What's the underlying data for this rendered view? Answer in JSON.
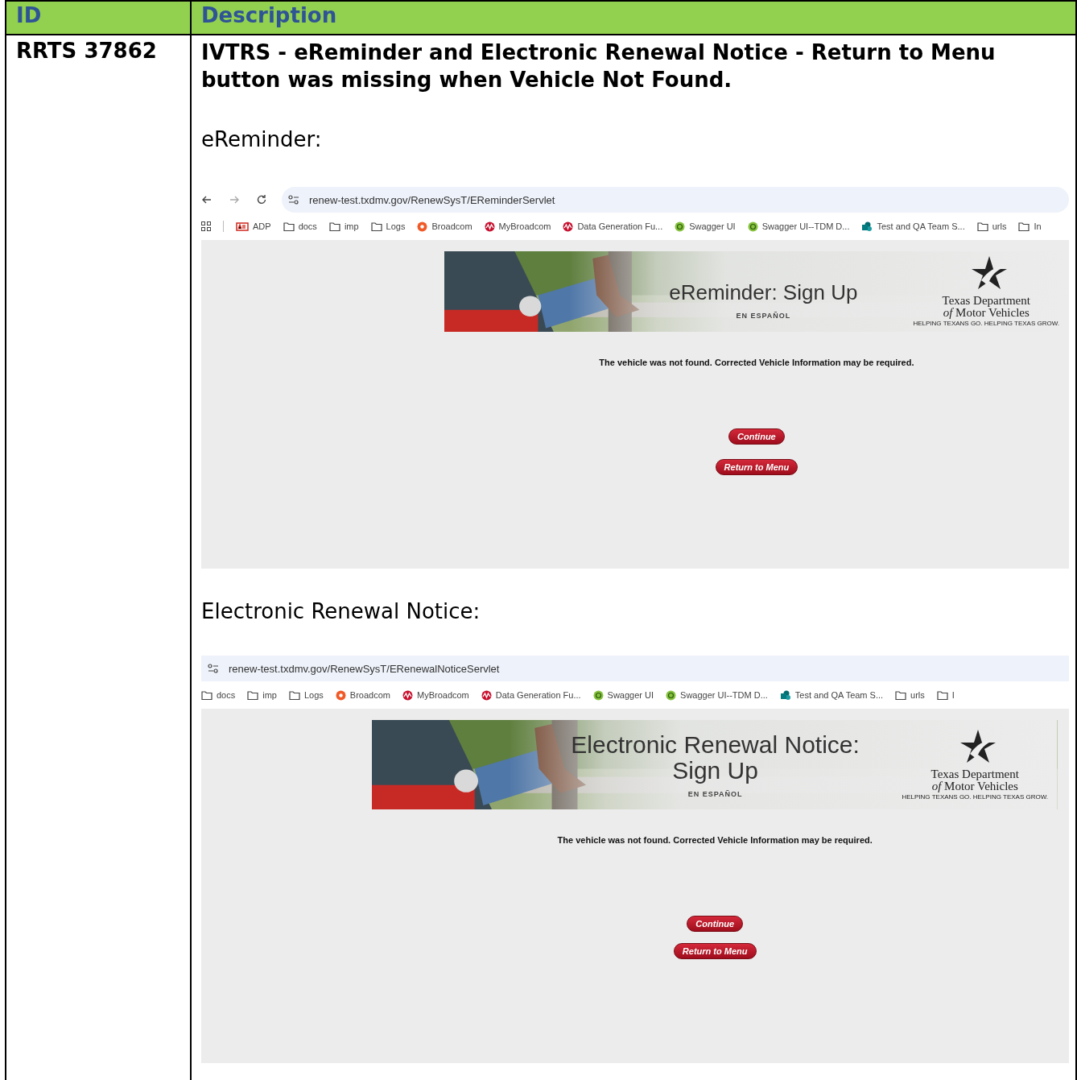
{
  "table": {
    "columns": [
      "ID",
      "Description"
    ],
    "rows": [
      {
        "id": "RRTS 37862",
        "title": "IVTRS - eReminder and Electronic Renewal Notice - Return to Menu button was missing when Vehicle Not Found.",
        "sections": [
          {
            "label": "eReminder:",
            "browser": {
              "nav_buttons": true,
              "url": "renew-test.txdmv.gov/RenewSysT/EReminderServlet",
              "bookmarks": [
                {
                  "label": "ADP",
                  "kind": "adp"
                },
                {
                  "label": "docs",
                  "kind": "folder"
                },
                {
                  "label": "imp",
                  "kind": "folder"
                },
                {
                  "label": "Logs",
                  "kind": "folder"
                },
                {
                  "label": "Broadcom",
                  "kind": "broadcom"
                },
                {
                  "label": "MyBroadcom",
                  "kind": "mybroadcom"
                },
                {
                  "label": "Data Generation Fu...",
                  "kind": "mybroadcom"
                },
                {
                  "label": "Swagger UI",
                  "kind": "swagger"
                },
                {
                  "label": "Swagger UI--TDM D...",
                  "kind": "swagger"
                },
                {
                  "label": "Test and QA Team S...",
                  "kind": "sharepoint"
                },
                {
                  "label": "urls",
                  "kind": "folder"
                },
                {
                  "label": "In",
                  "kind": "folder"
                }
              ],
              "banner": {
                "title_lines": [
                  "eReminder: Sign Up"
                ],
                "link": "EN ESPAÑOL",
                "logo": [
                  "Texas Department",
                  "*of* Motor Vehicles",
                  "HELPING TEXANS GO. HELPING TEXAS GROW."
                ]
              },
              "message": "The vehicle was not found. Corrected Vehicle Information may be required.",
              "buttons": [
                "Continue",
                "Return to Menu"
              ]
            }
          },
          {
            "label": "Electronic Renewal Notice:",
            "browser": {
              "nav_buttons": false,
              "url": "renew-test.txdmv.gov/RenewSysT/ERenewalNoticeServlet",
              "bookmarks": [
                {
                  "label": "docs",
                  "kind": "folder"
                },
                {
                  "label": "imp",
                  "kind": "folder"
                },
                {
                  "label": "Logs",
                  "kind": "folder"
                },
                {
                  "label": "Broadcom",
                  "kind": "broadcom"
                },
                {
                  "label": "MyBroadcom",
                  "kind": "mybroadcom"
                },
                {
                  "label": "Data Generation Fu...",
                  "kind": "mybroadcom"
                },
                {
                  "label": "Swagger UI",
                  "kind": "swagger"
                },
                {
                  "label": "Swagger UI--TDM D...",
                  "kind": "swagger"
                },
                {
                  "label": "Test and QA Team S...",
                  "kind": "sharepoint"
                },
                {
                  "label": "urls",
                  "kind": "folder"
                },
                {
                  "label": "I",
                  "kind": "folder"
                }
              ],
              "banner": {
                "title_lines": [
                  "Electronic Renewal Notice:",
                  "Sign Up"
                ],
                "link": "EN ESPAÑOL",
                "logo": [
                  "Texas Department",
                  "*of* Motor Vehicles",
                  "HELPING TEXANS GO. HELPING TEXAS GROW."
                ]
              },
              "message": "The vehicle was not found. Corrected Vehicle Information may be required.",
              "buttons": [
                "Continue",
                "Return to Menu"
              ]
            }
          }
        ]
      }
    ]
  }
}
